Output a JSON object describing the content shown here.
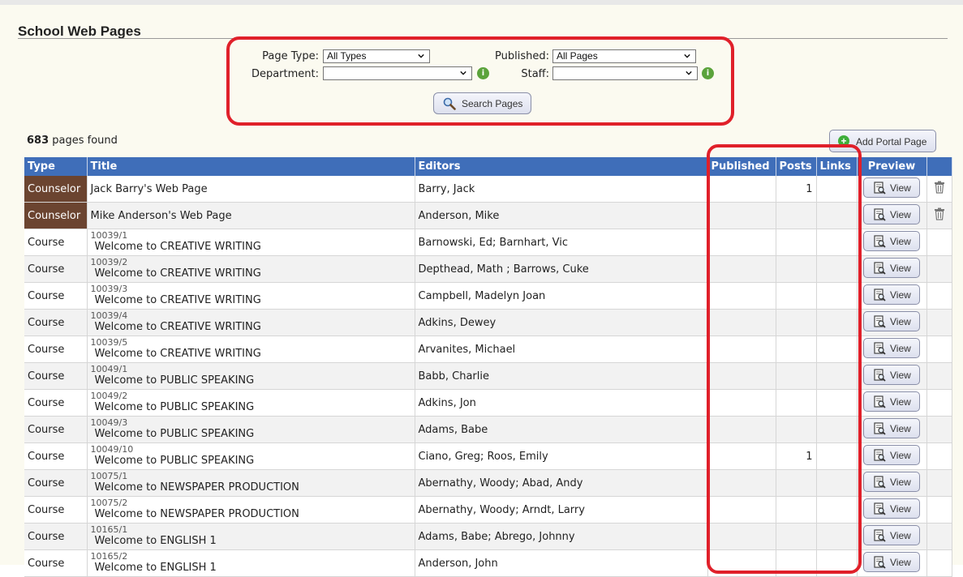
{
  "page": {
    "title": "School Web Pages"
  },
  "filters": {
    "page_type_label": "Page Type:",
    "page_type_value": "All Types",
    "published_label": "Published:",
    "published_value": "All Pages",
    "department_label": "Department:",
    "department_value": "",
    "staff_label": "Staff:",
    "staff_value": "",
    "info_glyph": "i",
    "search_button": "Search Pages"
  },
  "results": {
    "count": "683",
    "count_suffix": " pages found"
  },
  "add_portal_button": "Add Portal Page",
  "add_plus_glyph": "+",
  "table": {
    "headers": {
      "type": "Type",
      "title": "Title",
      "editors": "Editors",
      "published": "Published",
      "posts": "Posts",
      "links": "Links",
      "preview": "Preview"
    },
    "view_label": "View",
    "rows": [
      {
        "type": "Counselor",
        "num": "",
        "title": "Jack Barry's Web Page",
        "editors": "Barry, Jack",
        "published": "",
        "posts": "1",
        "links": ""
      },
      {
        "type": "Counselor",
        "num": "",
        "title": "Mike Anderson's Web Page",
        "editors": "Anderson, Mike",
        "published": "",
        "posts": "",
        "links": ""
      },
      {
        "type": "Course",
        "num": "10039/1",
        "title": "Welcome to CREATIVE WRITING",
        "editors": "Barnowski, Ed; Barnhart, Vic",
        "published": "",
        "posts": "",
        "links": ""
      },
      {
        "type": "Course",
        "num": "10039/2",
        "title": "Welcome to CREATIVE WRITING",
        "editors": "Depthead, Math ; Barrows, Cuke",
        "published": "",
        "posts": "",
        "links": ""
      },
      {
        "type": "Course",
        "num": "10039/3",
        "title": "Welcome to CREATIVE WRITING",
        "editors": "Campbell, Madelyn Joan",
        "published": "",
        "posts": "",
        "links": ""
      },
      {
        "type": "Course",
        "num": "10039/4",
        "title": "Welcome to CREATIVE WRITING",
        "editors": "Adkins, Dewey",
        "published": "",
        "posts": "",
        "links": ""
      },
      {
        "type": "Course",
        "num": "10039/5",
        "title": "Welcome to CREATIVE WRITING",
        "editors": "Arvanites, Michael",
        "published": "",
        "posts": "",
        "links": ""
      },
      {
        "type": "Course",
        "num": "10049/1",
        "title": "Welcome to PUBLIC SPEAKING",
        "editors": "Babb, Charlie",
        "published": "",
        "posts": "",
        "links": ""
      },
      {
        "type": "Course",
        "num": "10049/2",
        "title": "Welcome to PUBLIC SPEAKING",
        "editors": "Adkins, Jon",
        "published": "",
        "posts": "",
        "links": ""
      },
      {
        "type": "Course",
        "num": "10049/3",
        "title": "Welcome to PUBLIC SPEAKING",
        "editors": "Adams, Babe",
        "published": "",
        "posts": "",
        "links": ""
      },
      {
        "type": "Course",
        "num": "10049/10",
        "title": "Welcome to PUBLIC SPEAKING",
        "editors": "Ciano, Greg; Roos, Emily",
        "published": "",
        "posts": "1",
        "links": ""
      },
      {
        "type": "Course",
        "num": "10075/1",
        "title": "Welcome to NEWSPAPER PRODUCTION",
        "editors": "Abernathy, Woody; Abad, Andy",
        "published": "",
        "posts": "",
        "links": ""
      },
      {
        "type": "Course",
        "num": "10075/2",
        "title": "Welcome to NEWSPAPER PRODUCTION",
        "editors": "Abernathy, Woody; Arndt, Larry",
        "published": "",
        "posts": "",
        "links": ""
      },
      {
        "type": "Course",
        "num": "10165/1",
        "title": "Welcome to ENGLISH 1",
        "editors": "Adams, Babe; Abrego, Johnny",
        "published": "",
        "posts": "",
        "links": ""
      },
      {
        "type": "Course",
        "num": "10165/2",
        "title": "Welcome to ENGLISH 1",
        "editors": "Anderson, John",
        "published": "",
        "posts": "",
        "links": ""
      }
    ]
  },
  "colors": {
    "header_blue": "#3f6eb9",
    "counselor_brown": "#6b4430",
    "highlight_red": "#e0202a",
    "info_green": "#5ba33b"
  },
  "icons": {
    "search": "magnifier-icon",
    "view": "document-preview-icon",
    "delete": "trash-icon",
    "info": "info-icon",
    "add": "plus-circle-icon"
  }
}
